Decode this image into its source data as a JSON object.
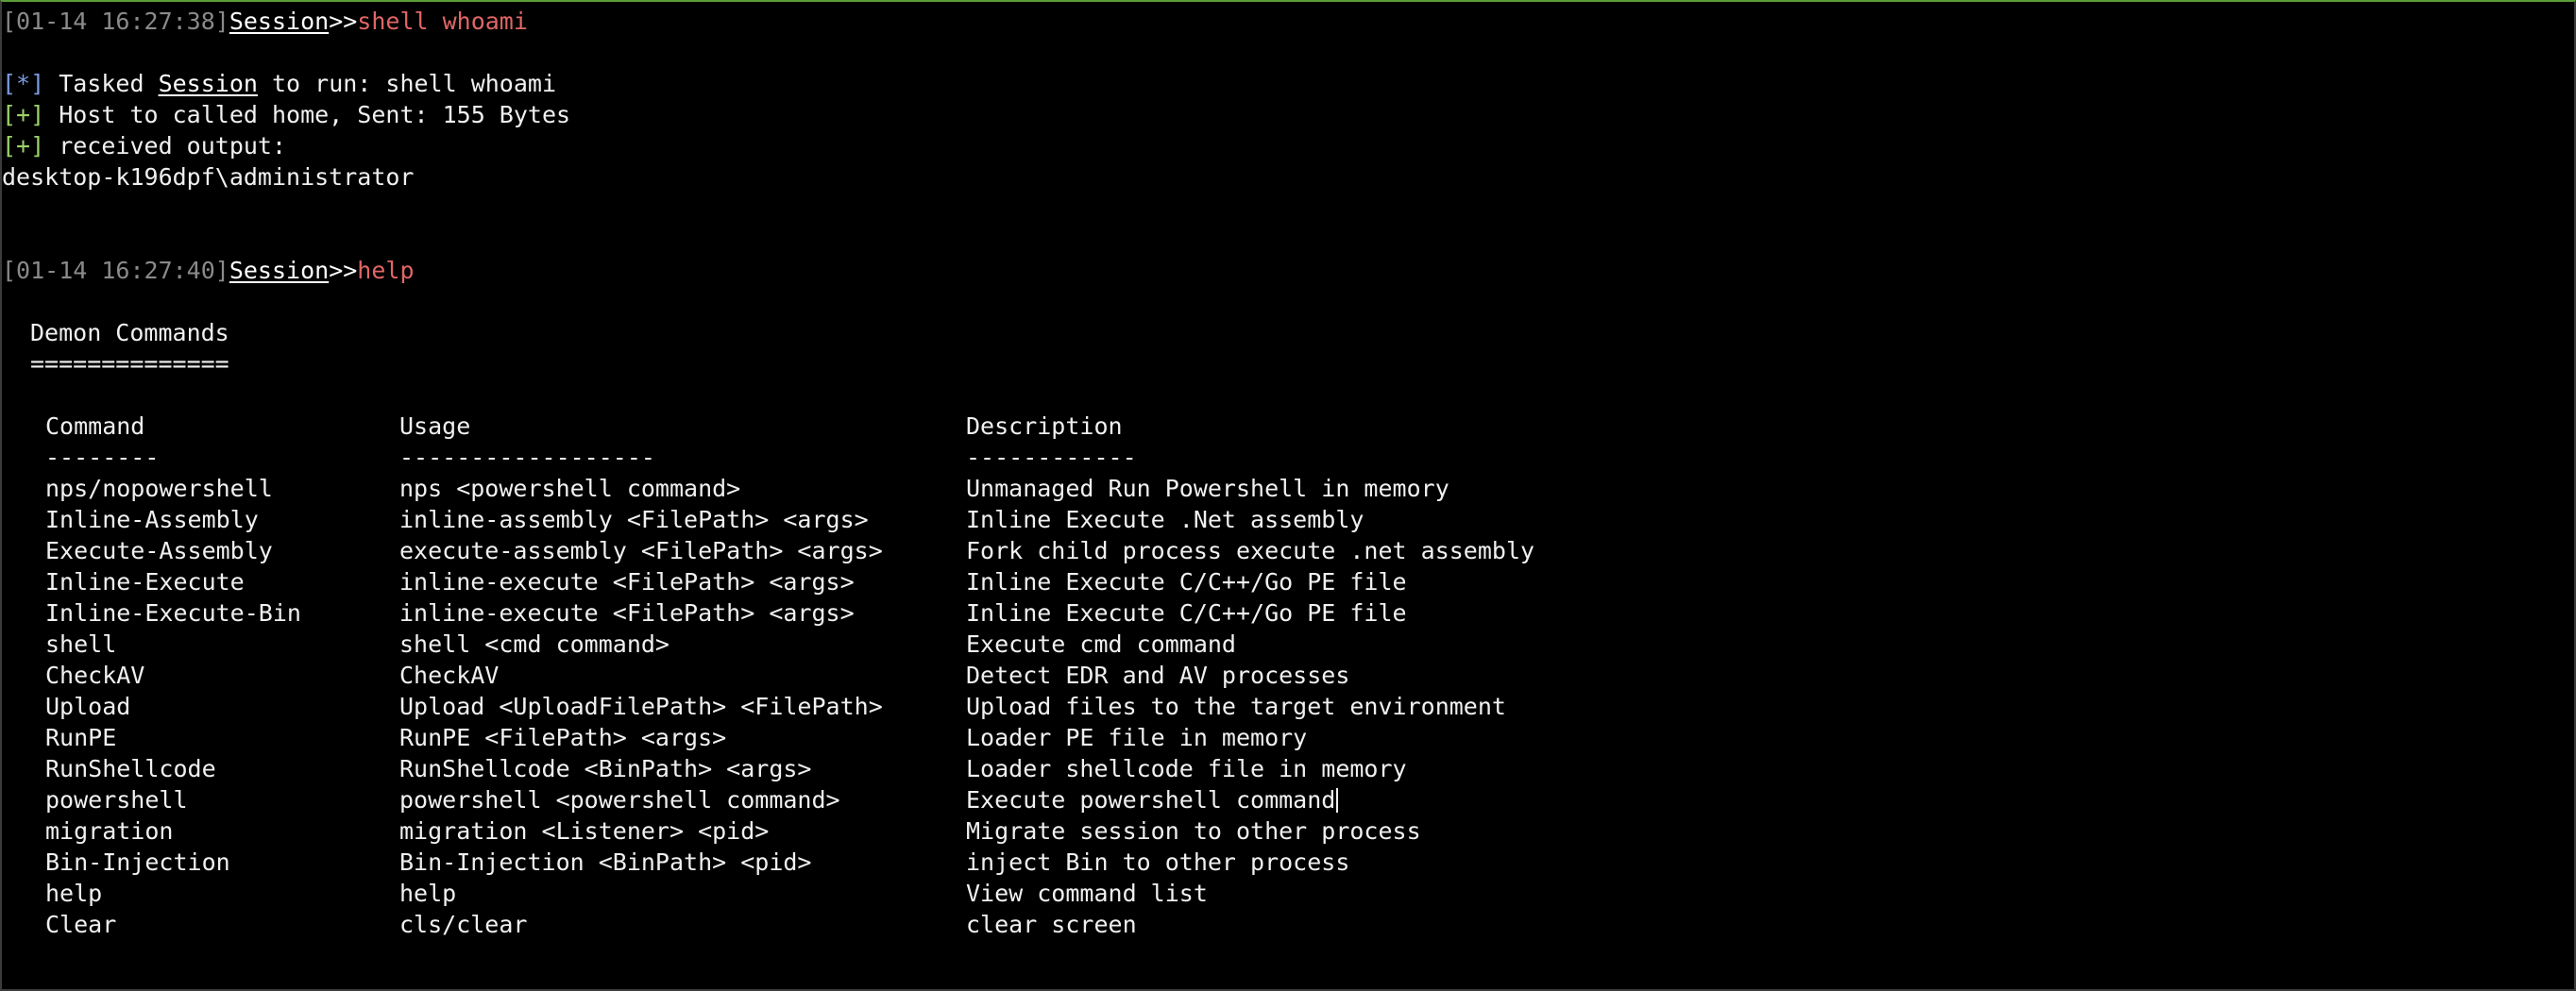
{
  "prompts": [
    {
      "timestamp": "[01-14 16:27:38]",
      "session": "Session",
      "arrow": ">>",
      "command": "shell whoami"
    },
    {
      "timestamp": "[01-14 16:27:40]",
      "session": "Session",
      "arrow": ">>",
      "command": "help"
    }
  ],
  "output": {
    "tasked_mark": "[*]",
    "tasked_prefix": " Tasked ",
    "tasked_session": "Session",
    "tasked_suffix": " to run: shell whoami",
    "sent_mark": "[+]",
    "sent_text": " Host to called home, Sent: 155 Bytes",
    "received_mark": "[+]",
    "received_text": " received output:",
    "result": "desktop-k196dpf\\administrator"
  },
  "help": {
    "title": "Demon Commands",
    "title_underline": "==============",
    "headers": {
      "command": "Command",
      "usage": "Usage",
      "description": "Description"
    },
    "header_underlines": {
      "command": "--------",
      "usage": "------------------",
      "description": "------------"
    },
    "rows": [
      {
        "command": "nps/nopowershell",
        "usage": "nps <powershell command>",
        "description": "Unmanaged Run Powershell in memory"
      },
      {
        "command": "Inline-Assembly",
        "usage": "inline-assembly <FilePath> <args>",
        "description": "Inline Execute .Net assembly"
      },
      {
        "command": "Execute-Assembly",
        "usage": "execute-assembly <FilePath> <args>",
        "description": "Fork child process execute .net assembly"
      },
      {
        "command": "Inline-Execute",
        "usage": "inline-execute <FilePath> <args>",
        "description": "Inline Execute C/C++/Go PE file"
      },
      {
        "command": "Inline-Execute-Bin",
        "usage": "inline-execute <FilePath> <args>",
        "description": "Inline Execute C/C++/Go PE file"
      },
      {
        "command": "shell",
        "usage": "shell <cmd command>",
        "description": "Execute cmd command"
      },
      {
        "command": "CheckAV",
        "usage": "CheckAV",
        "description": "Detect EDR and AV processes"
      },
      {
        "command": "Upload",
        "usage": "Upload <UploadFilePath> <FilePath>",
        "description": "Upload files to the target environment"
      },
      {
        "command": "RunPE",
        "usage": "RunPE <FilePath> <args>",
        "description": "Loader PE file in memory"
      },
      {
        "command": "RunShellcode",
        "usage": "RunShellcode <BinPath> <args>",
        "description": "Loader shellcode file in memory"
      },
      {
        "command": "powershell",
        "usage": "powershell <powershell command>",
        "description": "Execute powershell command"
      },
      {
        "command": "migration",
        "usage": "migration <Listener> <pid>",
        "description": "Migrate session to other process"
      },
      {
        "command": "Bin-Injection",
        "usage": "Bin-Injection <BinPath> <pid>",
        "description": "inject Bin to other process"
      },
      {
        "command": "help",
        "usage": "help",
        "description": "View command list"
      },
      {
        "command": "Clear",
        "usage": "cls/clear",
        "description": "clear screen"
      }
    ]
  },
  "colors": {
    "background": "#000000",
    "text": "#f0f0f0",
    "timestamp": "#8a8a8a",
    "command": "#e06666",
    "info_mark": "#7a9ae0",
    "success_mark": "#9bd26a",
    "top_border": "#5a9e3a"
  }
}
